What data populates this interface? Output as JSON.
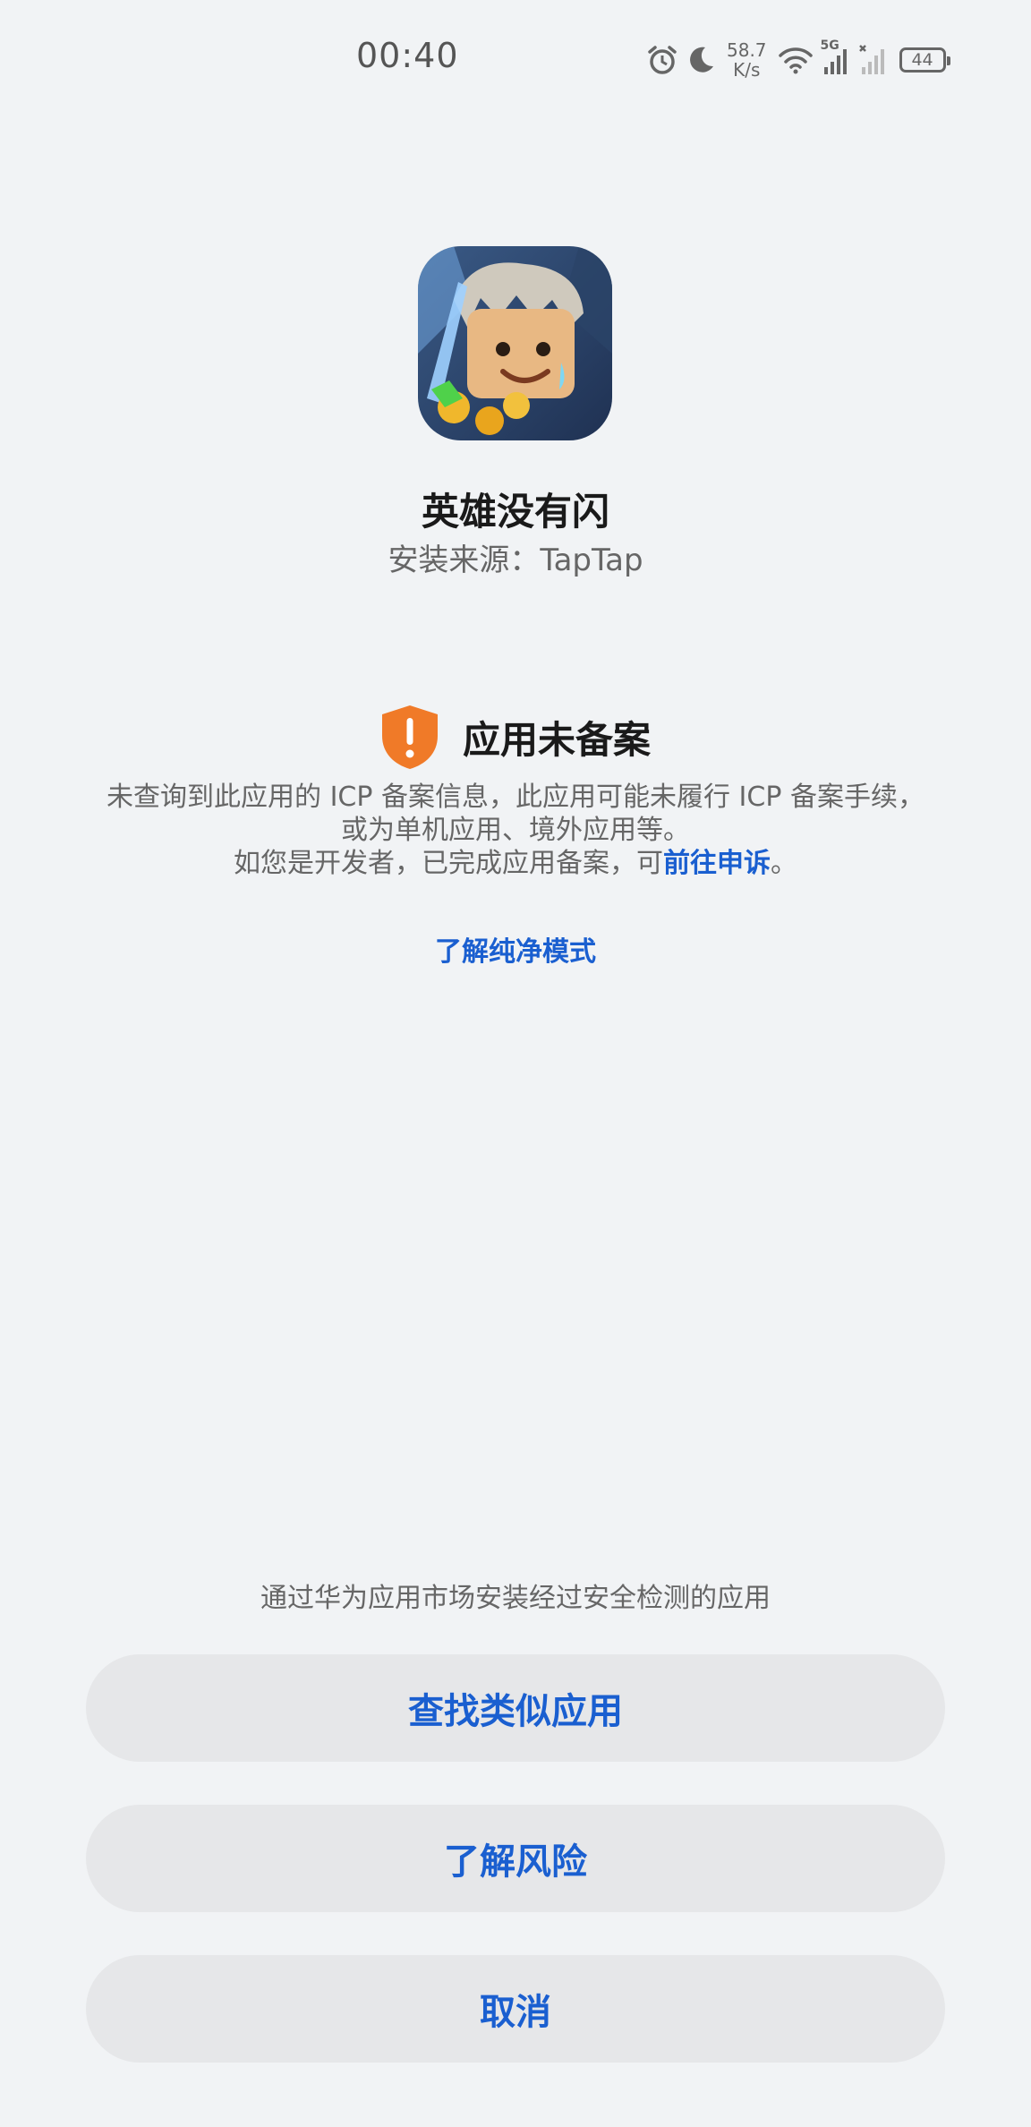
{
  "status_bar": {
    "time": "00:40",
    "net_speed_value": "58.7",
    "net_speed_unit": "K/s",
    "network_type": "5G",
    "battery": "44"
  },
  "app": {
    "name": "英雄没有闪",
    "source": "安装来源：TapTap"
  },
  "warning": {
    "title": "应用未备案",
    "desc_line1": "未查询到此应用的 ICP 备案信息，此应用可能未履行 ICP 备案手续，",
    "desc_line2": "或为单机应用、境外应用等。",
    "desc_line3_prefix": "如您是开发者，已完成应用备案，可",
    "appeal_link": "前往申诉",
    "desc_line3_suffix": "。",
    "pure_mode_link": "了解纯净模式"
  },
  "bottom": {
    "hint": "通过华为应用市场安装经过安全检测的应用",
    "find_similar_label": "查找类似应用",
    "learn_risk_label": "了解风险",
    "cancel_label": "取消"
  },
  "colors": {
    "accent": "#1a5fd0",
    "warning": "#f07a28",
    "background": "#f1f3f5",
    "button_bg": "#e6e7e9"
  },
  "icons": [
    "alarm-icon",
    "moon-icon",
    "wifi-icon",
    "signal-icon",
    "signal-no-sim-icon",
    "battery-icon",
    "warning-shield-icon"
  ]
}
